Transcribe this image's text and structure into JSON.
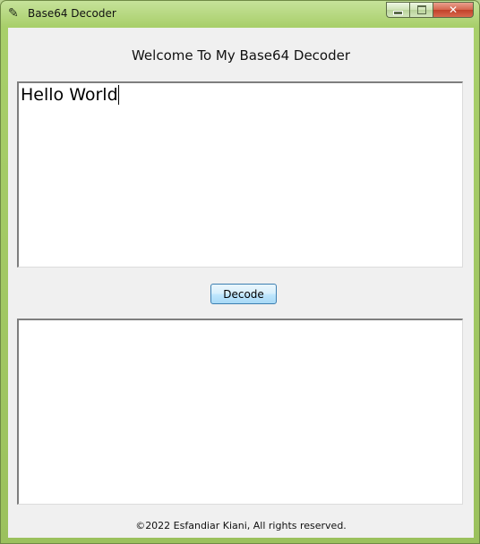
{
  "window": {
    "title": "Base64 Decoder",
    "app_icon": "feather-icon",
    "controls": {
      "minimize": "minimize-icon",
      "maximize": "maximize-icon",
      "close_label": "✕"
    }
  },
  "main": {
    "heading": "Welcome To My Base64 Decoder",
    "input_value": "Hello World",
    "decode_label": "Decode",
    "output_value": "",
    "footer": "©2022 Esfandiar Kiani, All rights reserved."
  },
  "colors": {
    "titlebar": "#a8cf6a",
    "client_bg": "#f0f0f0",
    "close_button": "#c1412a",
    "button_border": "#3c7fb1"
  }
}
